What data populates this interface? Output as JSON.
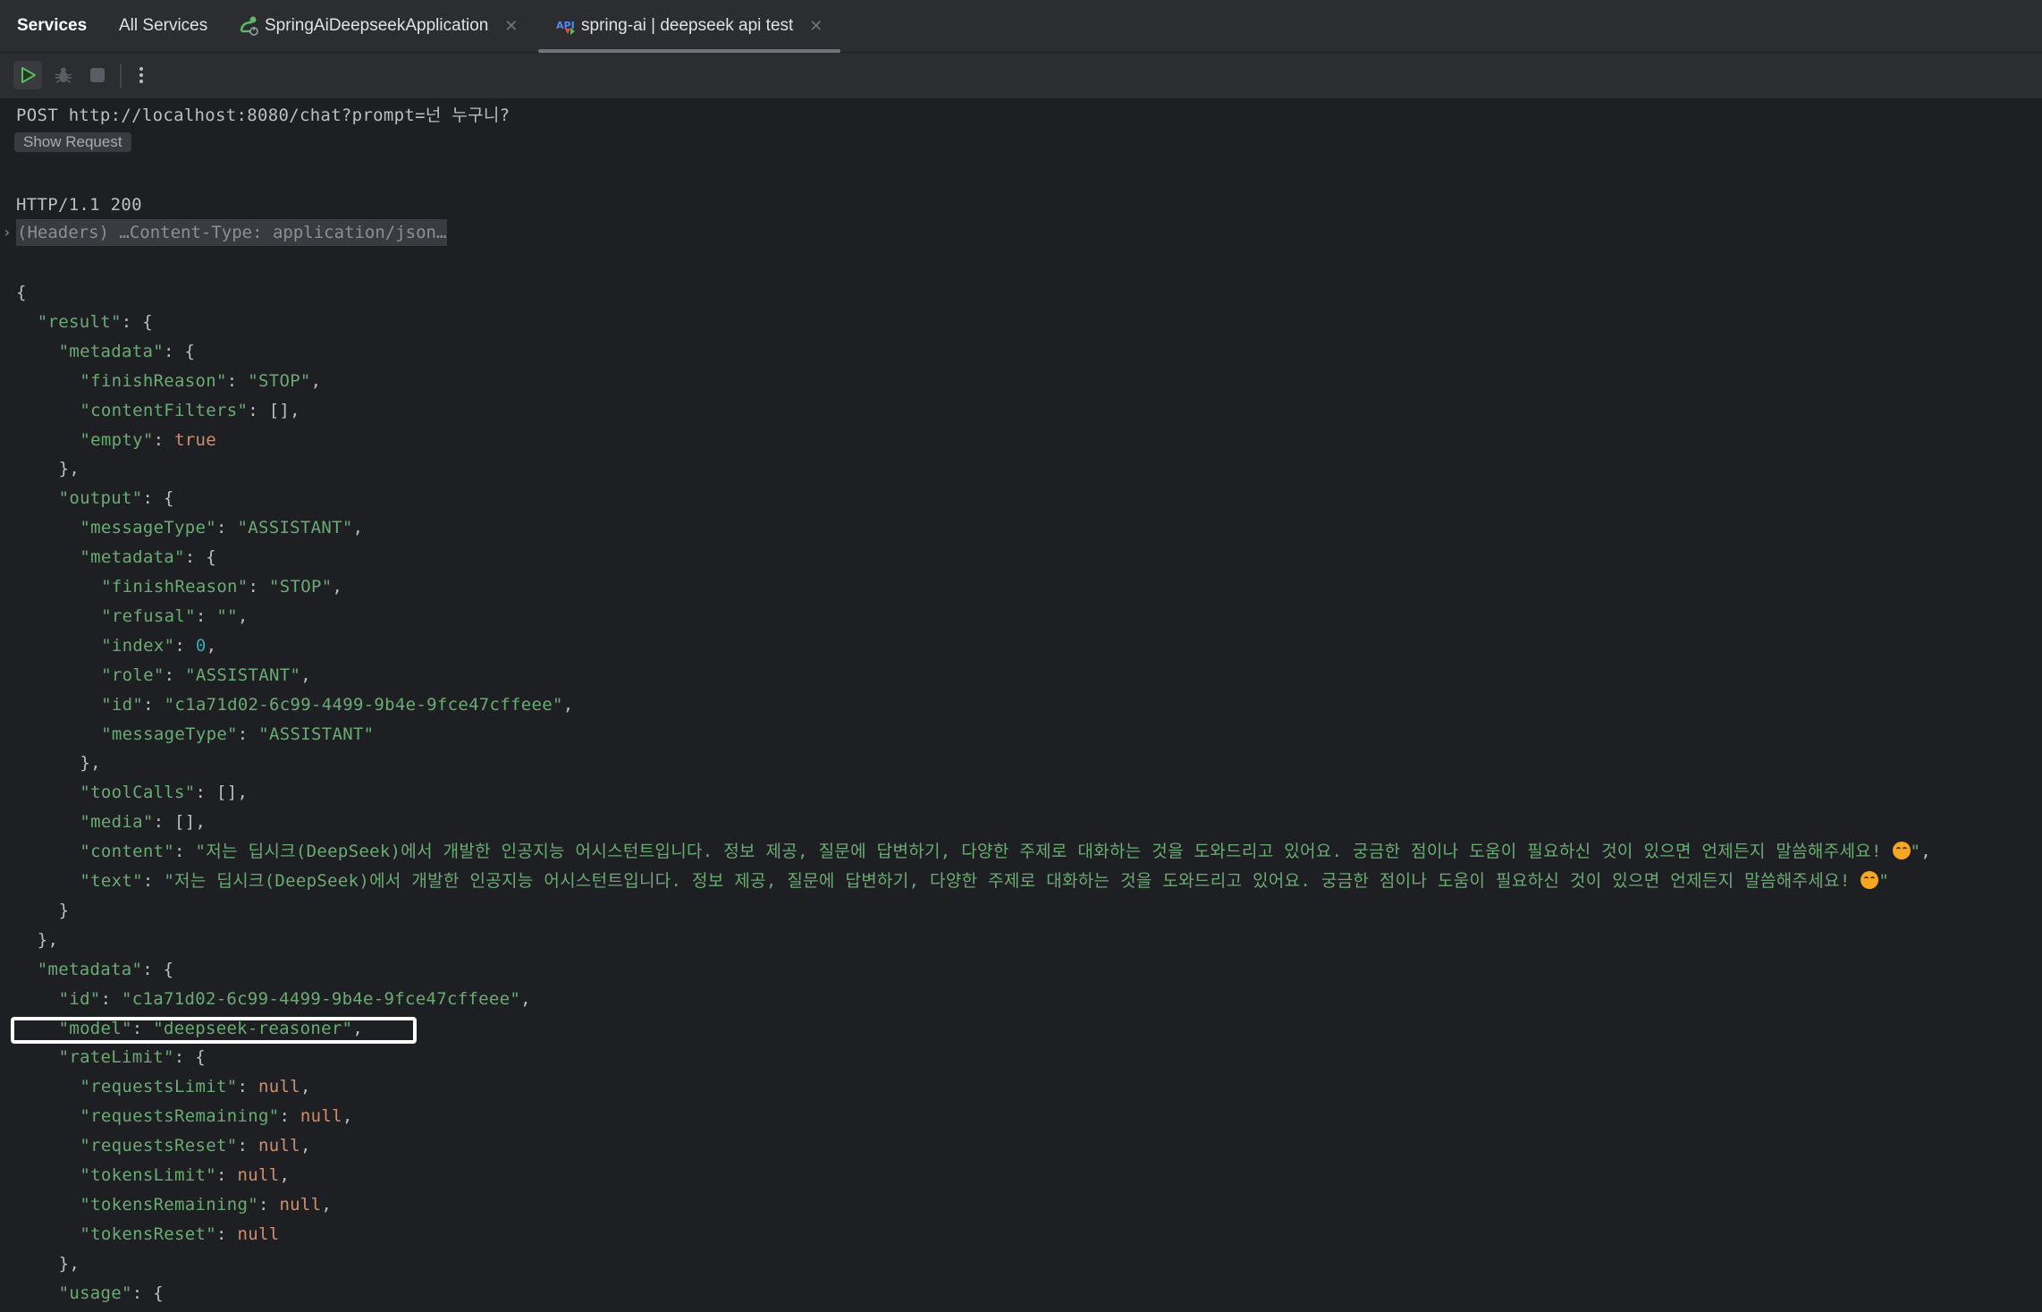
{
  "tabs": [
    {
      "label": "Services",
      "bold": true
    },
    {
      "label": "All Services"
    },
    {
      "label": "SpringAiDeepseekApplication",
      "icon": "spring-boot-app-icon",
      "closable": true
    },
    {
      "label": "spring-ai | deepseek api test",
      "icon": "http-api-icon",
      "closable": true,
      "active": true
    }
  ],
  "toolbar": {
    "buttons": [
      {
        "name": "run-button",
        "icon": "play-icon"
      },
      {
        "name": "debug-button",
        "icon": "bug-icon"
      },
      {
        "name": "stop-button",
        "icon": "stop-icon"
      },
      {
        "name": "more-button",
        "icon": "more-vertical-icon"
      }
    ]
  },
  "request": {
    "line": "POST http://localhost:8080/chat?prompt=넌 누구니?",
    "show_request_label": "Show Request"
  },
  "response": {
    "status_line": "HTTP/1.1 200",
    "headers_summary": "(Headers) …Content-Type: application/json…",
    "json_lines": [
      {
        "indent": 0,
        "tokens": [
          [
            "p",
            "{"
          ]
        ]
      },
      {
        "indent": 1,
        "tokens": [
          [
            "k",
            "\"result\""
          ],
          [
            "p",
            ": {"
          ]
        ]
      },
      {
        "indent": 2,
        "tokens": [
          [
            "k",
            "\"metadata\""
          ],
          [
            "p",
            ": {"
          ]
        ]
      },
      {
        "indent": 3,
        "tokens": [
          [
            "k",
            "\"finishReason\""
          ],
          [
            "p",
            ": "
          ],
          [
            "s",
            "\"STOP\""
          ],
          [
            "p",
            ","
          ]
        ]
      },
      {
        "indent": 3,
        "tokens": [
          [
            "k",
            "\"contentFilters\""
          ],
          [
            "p",
            ": [],"
          ]
        ]
      },
      {
        "indent": 3,
        "tokens": [
          [
            "k",
            "\"empty\""
          ],
          [
            "p",
            ": "
          ],
          [
            "kw",
            "true"
          ]
        ]
      },
      {
        "indent": 2,
        "tokens": [
          [
            "p",
            "},"
          ]
        ]
      },
      {
        "indent": 2,
        "tokens": [
          [
            "k",
            "\"output\""
          ],
          [
            "p",
            ": {"
          ]
        ]
      },
      {
        "indent": 3,
        "tokens": [
          [
            "k",
            "\"messageType\""
          ],
          [
            "p",
            ": "
          ],
          [
            "s",
            "\"ASSISTANT\""
          ],
          [
            "p",
            ","
          ]
        ]
      },
      {
        "indent": 3,
        "tokens": [
          [
            "k",
            "\"metadata\""
          ],
          [
            "p",
            ": {"
          ]
        ]
      },
      {
        "indent": 4,
        "tokens": [
          [
            "k",
            "\"finishReason\""
          ],
          [
            "p",
            ": "
          ],
          [
            "s",
            "\"STOP\""
          ],
          [
            "p",
            ","
          ]
        ]
      },
      {
        "indent": 4,
        "tokens": [
          [
            "k",
            "\"refusal\""
          ],
          [
            "p",
            ": "
          ],
          [
            "s",
            "\"\""
          ],
          [
            "p",
            ","
          ]
        ]
      },
      {
        "indent": 4,
        "tokens": [
          [
            "k",
            "\"index\""
          ],
          [
            "p",
            ": "
          ],
          [
            "n",
            "0"
          ],
          [
            "p",
            ","
          ]
        ]
      },
      {
        "indent": 4,
        "tokens": [
          [
            "k",
            "\"role\""
          ],
          [
            "p",
            ": "
          ],
          [
            "s",
            "\"ASSISTANT\""
          ],
          [
            "p",
            ","
          ]
        ]
      },
      {
        "indent": 4,
        "tokens": [
          [
            "k",
            "\"id\""
          ],
          [
            "p",
            ": "
          ],
          [
            "s",
            "\"c1a71d02-6c99-4499-9b4e-9fce47cffeee\""
          ],
          [
            "p",
            ","
          ]
        ]
      },
      {
        "indent": 4,
        "tokens": [
          [
            "k",
            "\"messageType\""
          ],
          [
            "p",
            ": "
          ],
          [
            "s",
            "\"ASSISTANT\""
          ]
        ]
      },
      {
        "indent": 3,
        "tokens": [
          [
            "p",
            "},"
          ]
        ]
      },
      {
        "indent": 3,
        "tokens": [
          [
            "k",
            "\"toolCalls\""
          ],
          [
            "p",
            ": [],"
          ]
        ]
      },
      {
        "indent": 3,
        "tokens": [
          [
            "k",
            "\"media\""
          ],
          [
            "p",
            ": [],"
          ]
        ]
      },
      {
        "indent": 3,
        "tokens": [
          [
            "k",
            "\"content\""
          ],
          [
            "p",
            ": "
          ],
          [
            "s",
            "\"저는 딥시크(DeepSeek)에서 개발한 인공지능 어시스턴트입니다. 정보 제공, 질문에 답변하기, 다양한 주제로 대화하는 것을 도와드리고 있어요. 궁금한 점이나 도움이 필요하신 것이 있으면 언제든지 말씀해주세요! "
          ],
          [
            "emoji",
            "smiling-face-emoji"
          ],
          [
            "s",
            "\""
          ],
          [
            "p",
            ","
          ]
        ]
      },
      {
        "indent": 3,
        "tokens": [
          [
            "k",
            "\"text\""
          ],
          [
            "p",
            ": "
          ],
          [
            "s",
            "\"저는 딥시크(DeepSeek)에서 개발한 인공지능 어시스턴트입니다. 정보 제공, 질문에 답변하기, 다양한 주제로 대화하는 것을 도와드리고 있어요. 궁금한 점이나 도움이 필요하신 것이 있으면 언제든지 말씀해주세요! "
          ],
          [
            "emoji",
            "smiling-face-emoji"
          ],
          [
            "s",
            "\""
          ]
        ]
      },
      {
        "indent": 2,
        "tokens": [
          [
            "p",
            "}"
          ]
        ]
      },
      {
        "indent": 1,
        "tokens": [
          [
            "p",
            "},"
          ]
        ]
      },
      {
        "indent": 1,
        "tokens": [
          [
            "k",
            "\"metadata\""
          ],
          [
            "p",
            ": {"
          ]
        ]
      },
      {
        "indent": 2,
        "tokens": [
          [
            "k",
            "\"id\""
          ],
          [
            "p",
            ": "
          ],
          [
            "s",
            "\"c1a71d02-6c99-4499-9b4e-9fce47cffeee\""
          ],
          [
            "p",
            ","
          ]
        ]
      },
      {
        "indent": 2,
        "highlighted": true,
        "tokens": [
          [
            "k",
            "\"model\""
          ],
          [
            "p",
            ": "
          ],
          [
            "s",
            "\"deepseek-reasoner\""
          ],
          [
            "p",
            ","
          ]
        ]
      },
      {
        "indent": 2,
        "tokens": [
          [
            "k",
            "\"rateLimit\""
          ],
          [
            "p",
            ": {"
          ]
        ]
      },
      {
        "indent": 3,
        "tokens": [
          [
            "k",
            "\"requestsLimit\""
          ],
          [
            "p",
            ": "
          ],
          [
            "kw",
            "null"
          ],
          [
            "p",
            ","
          ]
        ]
      },
      {
        "indent": 3,
        "tokens": [
          [
            "k",
            "\"requestsRemaining\""
          ],
          [
            "p",
            ": "
          ],
          [
            "kw",
            "null"
          ],
          [
            "p",
            ","
          ]
        ]
      },
      {
        "indent": 3,
        "tokens": [
          [
            "k",
            "\"requestsReset\""
          ],
          [
            "p",
            ": "
          ],
          [
            "kw",
            "null"
          ],
          [
            "p",
            ","
          ]
        ]
      },
      {
        "indent": 3,
        "tokens": [
          [
            "k",
            "\"tokensLimit\""
          ],
          [
            "p",
            ": "
          ],
          [
            "kw",
            "null"
          ],
          [
            "p",
            ","
          ]
        ]
      },
      {
        "indent": 3,
        "tokens": [
          [
            "k",
            "\"tokensRemaining\""
          ],
          [
            "p",
            ": "
          ],
          [
            "kw",
            "null"
          ],
          [
            "p",
            ","
          ]
        ]
      },
      {
        "indent": 3,
        "tokens": [
          [
            "k",
            "\"tokensReset\""
          ],
          [
            "p",
            ": "
          ],
          [
            "kw",
            "null"
          ]
        ]
      },
      {
        "indent": 2,
        "tokens": [
          [
            "p",
            "},"
          ]
        ]
      },
      {
        "indent": 2,
        "tokens": [
          [
            "k",
            "\"usage\""
          ],
          [
            "p",
            ": {"
          ]
        ]
      }
    ]
  },
  "colors": {
    "background": "#1e1f22",
    "panel": "#2b2d30",
    "json_key_string": "#6aab73",
    "json_keyword": "#cf8e6d",
    "json_number": "#2aacb8",
    "punctuation": "#bcbec4",
    "run_green": "#5fb865"
  }
}
